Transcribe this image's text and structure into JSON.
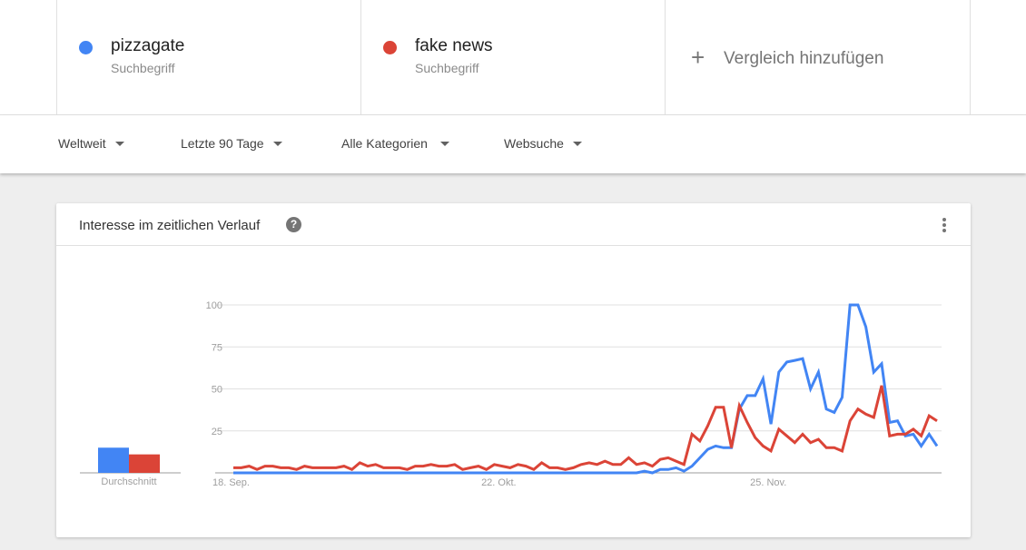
{
  "terms": [
    {
      "name": "pizzagate",
      "type": "Suchbegriff",
      "color": "#4285f4"
    },
    {
      "name": "fake news",
      "type": "Suchbegriff",
      "color": "#db4437"
    }
  ],
  "add_comparison": {
    "icon": "plus-icon",
    "label": "Vergleich hinzufügen"
  },
  "filters": [
    {
      "label": "Weltweit"
    },
    {
      "label": "Letzte 90 Tage"
    },
    {
      "label": "Alle Kategorien"
    },
    {
      "label": "Websuche"
    }
  ],
  "card": {
    "title": "Interesse im zeitlichen Verlauf",
    "help_icon": "?",
    "more_icon": "more-vert-icon"
  },
  "chart_data": {
    "type": "line",
    "title": "Interesse im zeitlichen Verlauf",
    "xlabel": "",
    "ylabel": "",
    "ylim": [
      0,
      100
    ],
    "yticks": [
      25,
      50,
      75,
      100
    ],
    "xtick_labels": [
      {
        "label": "18. Sep.",
        "index": 0
      },
      {
        "label": "22. Okt.",
        "index": 34
      },
      {
        "label": "25. Nov.",
        "index": 68
      }
    ],
    "grid": true,
    "average_label": "Durchschnitt",
    "series": [
      {
        "name": "pizzagate",
        "color": "#4285f4",
        "average": 15,
        "values": [
          0,
          0,
          0,
          0,
          0,
          0,
          0,
          0,
          0,
          0,
          0,
          0,
          0,
          0,
          0,
          0,
          0,
          0,
          0,
          0,
          0,
          0,
          0,
          0,
          0,
          0,
          0,
          0,
          0,
          0,
          0,
          0,
          0,
          0,
          0,
          0,
          0,
          0,
          0,
          0,
          0,
          0,
          0,
          0,
          0,
          0,
          0,
          0,
          0,
          0,
          0,
          0,
          1,
          0,
          2,
          2,
          3,
          1,
          4,
          9,
          14,
          16,
          15,
          15,
          38,
          46,
          46,
          56,
          29,
          60,
          66,
          67,
          68,
          50,
          60,
          38,
          36,
          45,
          100,
          100,
          87,
          60,
          65,
          30,
          31,
          22,
          23,
          16,
          23,
          16
        ]
      },
      {
        "name": "fake news",
        "color": "#db4437",
        "average": 11,
        "values": [
          3,
          3,
          4,
          2,
          4,
          4,
          3,
          3,
          2,
          4,
          3,
          3,
          3,
          3,
          4,
          2,
          6,
          4,
          5,
          3,
          3,
          3,
          2,
          4,
          4,
          5,
          4,
          4,
          5,
          2,
          3,
          4,
          2,
          5,
          4,
          3,
          5,
          4,
          2,
          6,
          3,
          3,
          2,
          3,
          5,
          6,
          5,
          7,
          5,
          5,
          9,
          5,
          6,
          4,
          8,
          9,
          7,
          5,
          23,
          19,
          28,
          39,
          39,
          15,
          40,
          30,
          21,
          16,
          13,
          26,
          22,
          18,
          23,
          18,
          20,
          15,
          15,
          13,
          31,
          38,
          35,
          33,
          52,
          22,
          23,
          23,
          26,
          22,
          34,
          31
        ]
      }
    ]
  }
}
